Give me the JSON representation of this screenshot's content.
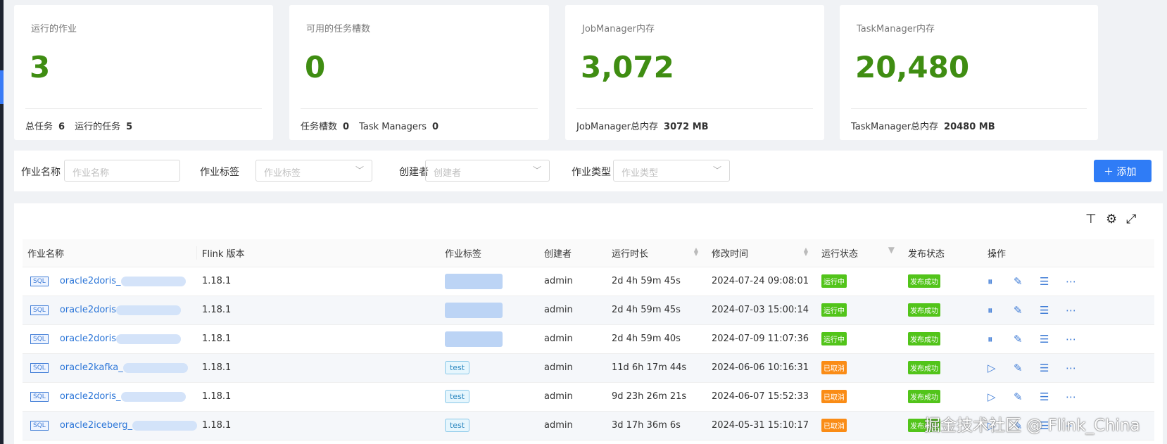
{
  "cards": [
    {
      "title": "运行的作业",
      "value": "3",
      "foot": [
        {
          "label": "总任务",
          "value": "6"
        },
        {
          "label": "运行的任务",
          "value": "5"
        }
      ]
    },
    {
      "title": "可用的任务槽数",
      "value": "0",
      "foot": [
        {
          "label": "任务槽数",
          "value": "0"
        },
        {
          "label": "Task Managers",
          "value": "0"
        }
      ]
    },
    {
      "title": "JobManager内存",
      "value": "3,072",
      "foot": [
        {
          "label": "JobManager总内存",
          "value": "3072 MB"
        }
      ]
    },
    {
      "title": "TaskManager内存",
      "value": "20,480",
      "foot": [
        {
          "label": "TaskManager总内存",
          "value": "20480 MB"
        }
      ]
    }
  ],
  "filters": {
    "name_label": "作业名称",
    "name_placeholder": "作业名称",
    "tag_label": "作业标签",
    "tag_placeholder": "作业标签",
    "creator_label": "创建者",
    "creator_placeholder": "创建者",
    "type_label": "作业类型",
    "type_placeholder": "作业类型",
    "add_label": "添加"
  },
  "table": {
    "headers": {
      "name": "作业名称",
      "flink": "Flink 版本",
      "tags": "作业标签",
      "creator": "创建者",
      "duration": "运行时长",
      "modified": "修改时间",
      "run_status": "运行状态",
      "publish_status": "发布状态",
      "actions": "操作"
    },
    "rows": [
      {
        "type": "SQL",
        "name": "oracle2doris_",
        "version": "1.18.1",
        "tag": "",
        "creator": "admin",
        "duration": "2d 4h 59m 45s",
        "modified": "2024-07-24 09:08:01",
        "run_status": "运行中",
        "publish_status": "发布成功"
      },
      {
        "type": "SQL",
        "name": "oracle2doris",
        "version": "1.18.1",
        "tag": "",
        "creator": "admin",
        "duration": "2d 4h 59m 45s",
        "modified": "2024-07-03 15:00:14",
        "run_status": "运行中",
        "publish_status": "发布成功"
      },
      {
        "type": "SQL",
        "name": "oracle2doris",
        "version": "1.18.1",
        "tag": "",
        "creator": "admin",
        "duration": "2d 4h 59m 40s",
        "modified": "2024-07-09 11:07:36",
        "run_status": "运行中",
        "publish_status": "发布成功"
      },
      {
        "type": "SQL",
        "name": "oracle2kafka_",
        "version": "1.18.1",
        "tag": "test",
        "creator": "admin",
        "duration": "11d 6h 17m 44s",
        "modified": "2024-06-06 10:16:31",
        "run_status": "已取消",
        "publish_status": "发布成功"
      },
      {
        "type": "SQL",
        "name": "oracle2doris_",
        "version": "1.18.1",
        "tag": "test",
        "creator": "admin",
        "duration": "9d 23h 26m 21s",
        "modified": "2024-06-07 15:52:33",
        "run_status": "已取消",
        "publish_status": "发布成功"
      },
      {
        "type": "SQL",
        "name": "oracle2iceberg_",
        "version": "1.18.1",
        "tag": "test",
        "creator": "admin",
        "duration": "3d 17h 36m 6s",
        "modified": "2024-05-31 15:10:17",
        "run_status": "已取消",
        "publish_status": "发布成功"
      }
    ]
  },
  "watermark": "掘金技术社区 @ Flink_China",
  "colors": {
    "accent": "#2f7cf6",
    "metric": "#3f8d12",
    "running": "#52c41a",
    "cancelled": "#fa8c16"
  }
}
